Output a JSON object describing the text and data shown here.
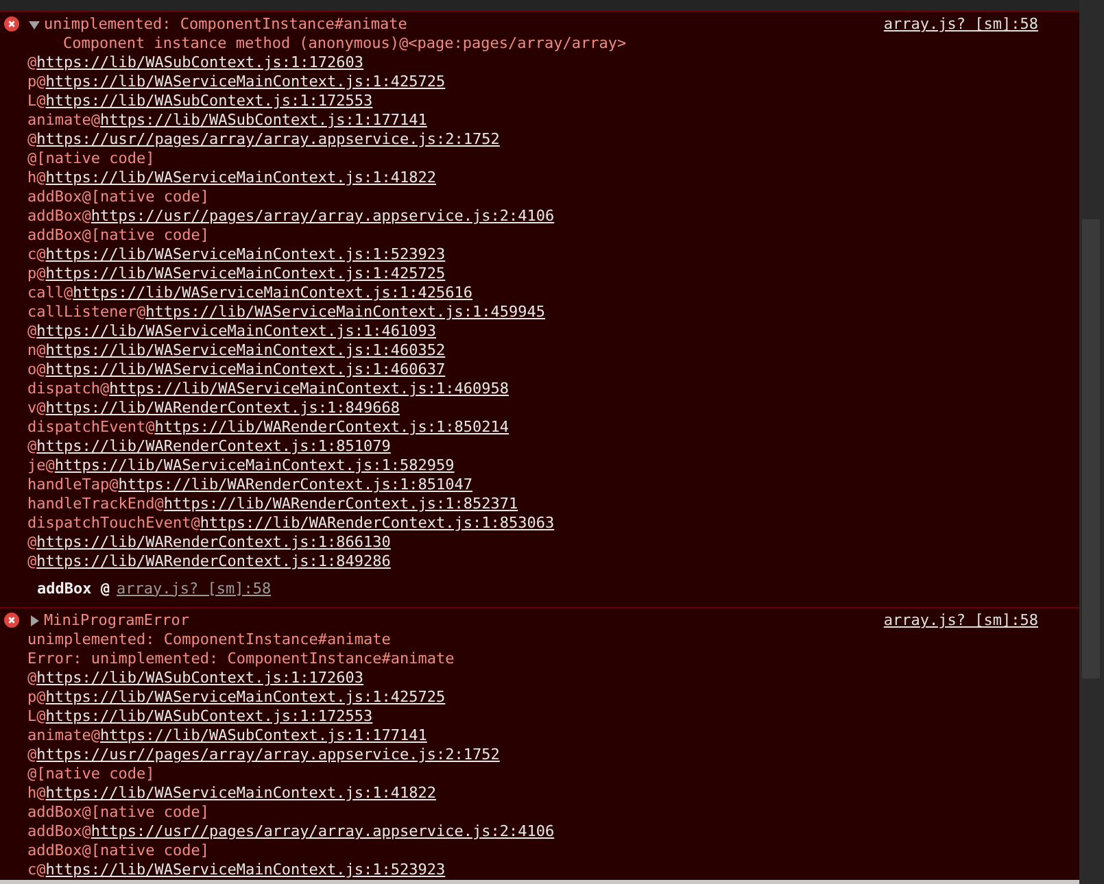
{
  "messages": [
    {
      "expanded": true,
      "title": "unimplemented: ComponentInstance#animate",
      "source": "array.js? [sm]:58",
      "details": [
        {
          "kind": "indented",
          "text": "Component instance method (anonymous)@<page:pages/array/array>"
        }
      ],
      "frames": [
        {
          "fn": "@",
          "kind": "link",
          "location": "https://lib/WASubContext.js:1:172603"
        },
        {
          "fn": "p@",
          "kind": "link",
          "location": "https://lib/WAServiceMainContext.js:1:425725"
        },
        {
          "fn": "L@",
          "kind": "link",
          "location": "https://lib/WASubContext.js:1:172553"
        },
        {
          "fn": "animate@",
          "kind": "link",
          "location": "https://lib/WASubContext.js:1:177141"
        },
        {
          "fn": "@",
          "kind": "link",
          "location": "https://usr//pages/array/array.appservice.js:2:1752"
        },
        {
          "fn": "@",
          "kind": "native",
          "location": "[native code]"
        },
        {
          "fn": "h@",
          "kind": "link",
          "location": "https://lib/WAServiceMainContext.js:1:41822"
        },
        {
          "fn": "addBox@",
          "kind": "native",
          "location": "[native code]"
        },
        {
          "fn": "addBox@",
          "kind": "link",
          "location": "https://usr//pages/array/array.appservice.js:2:4106"
        },
        {
          "fn": "addBox@",
          "kind": "native",
          "location": "[native code]"
        },
        {
          "fn": "c@",
          "kind": "link",
          "location": "https://lib/WAServiceMainContext.js:1:523923"
        },
        {
          "fn": "p@",
          "kind": "link",
          "location": "https://lib/WAServiceMainContext.js:1:425725"
        },
        {
          "fn": "call@",
          "kind": "link",
          "location": "https://lib/WAServiceMainContext.js:1:425616"
        },
        {
          "fn": "callListener@",
          "kind": "link",
          "location": "https://lib/WAServiceMainContext.js:1:459945"
        },
        {
          "fn": "@",
          "kind": "link",
          "location": "https://lib/WAServiceMainContext.js:1:461093"
        },
        {
          "fn": "n@",
          "kind": "link",
          "location": "https://lib/WAServiceMainContext.js:1:460352"
        },
        {
          "fn": "o@",
          "kind": "link",
          "location": "https://lib/WAServiceMainContext.js:1:460637"
        },
        {
          "fn": "dispatch@",
          "kind": "link",
          "location": "https://lib/WAServiceMainContext.js:1:460958"
        },
        {
          "fn": "v@",
          "kind": "link",
          "location": "https://lib/WARenderContext.js:1:849668"
        },
        {
          "fn": "dispatchEvent@",
          "kind": "link",
          "location": "https://lib/WARenderContext.js:1:850214"
        },
        {
          "fn": "@",
          "kind": "link",
          "location": "https://lib/WARenderContext.js:1:851079"
        },
        {
          "fn": "je@",
          "kind": "link",
          "location": "https://lib/WAServiceMainContext.js:1:582959"
        },
        {
          "fn": "handleTap@",
          "kind": "link",
          "location": "https://lib/WARenderContext.js:1:851047"
        },
        {
          "fn": "handleTrackEnd@",
          "kind": "link",
          "location": "https://lib/WARenderContext.js:1:852371"
        },
        {
          "fn": "dispatchTouchEvent@",
          "kind": "link",
          "location": "https://lib/WARenderContext.js:1:853063"
        },
        {
          "fn": "@",
          "kind": "link",
          "location": "https://lib/WARenderContext.js:1:866130"
        },
        {
          "fn": "@",
          "kind": "link",
          "location": "https://lib/WARenderContext.js:1:849286"
        }
      ],
      "summary": {
        "fn": "addBox @",
        "source": "array.js? [sm]:58"
      }
    },
    {
      "expanded": false,
      "title": "MiniProgramError",
      "source": "array.js? [sm]:58",
      "details": [
        {
          "kind": "plain",
          "text": "unimplemented: ComponentInstance#animate"
        },
        {
          "kind": "plain",
          "text": "Error: unimplemented: ComponentInstance#animate"
        }
      ],
      "frames": [
        {
          "fn": "@",
          "kind": "link",
          "location": "https://lib/WASubContext.js:1:172603"
        },
        {
          "fn": "p@",
          "kind": "link",
          "location": "https://lib/WAServiceMainContext.js:1:425725"
        },
        {
          "fn": "L@",
          "kind": "link",
          "location": "https://lib/WASubContext.js:1:172553"
        },
        {
          "fn": "animate@",
          "kind": "link",
          "location": "https://lib/WASubContext.js:1:177141"
        },
        {
          "fn": "@",
          "kind": "link",
          "location": "https://usr//pages/array/array.appservice.js:2:1752"
        },
        {
          "fn": "@",
          "kind": "native",
          "location": "[native code]"
        },
        {
          "fn": "h@",
          "kind": "link",
          "location": "https://lib/WAServiceMainContext.js:1:41822"
        },
        {
          "fn": "addBox@",
          "kind": "native",
          "location": "[native code]"
        },
        {
          "fn": "addBox@",
          "kind": "link",
          "location": "https://usr//pages/array/array.appservice.js:2:4106"
        },
        {
          "fn": "addBox@",
          "kind": "native",
          "location": "[native code]"
        },
        {
          "fn": "c@",
          "kind": "link",
          "location": "https://lib/WAServiceMainContext.js:1:523923"
        }
      ]
    }
  ]
}
